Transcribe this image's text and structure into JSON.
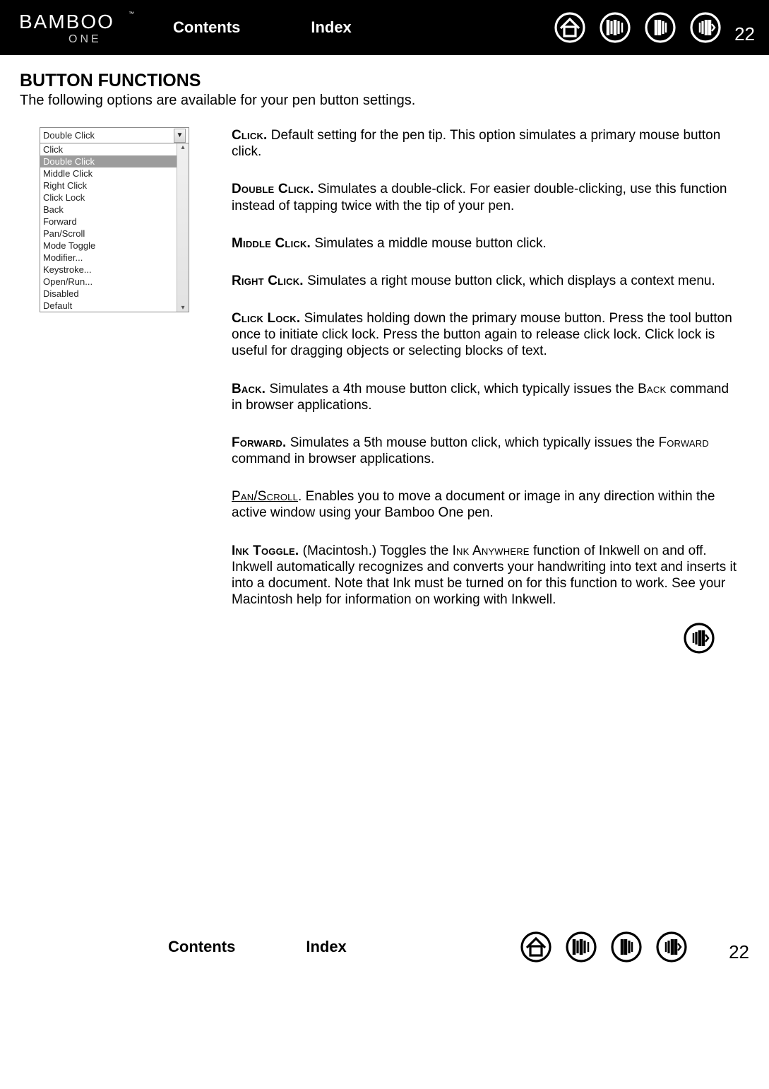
{
  "header": {
    "contents": "Contents",
    "index": "Index",
    "page": "22"
  },
  "title": "BUTTON FUNCTIONS",
  "intro": "The following options are available for your pen button settings.",
  "dropdown": {
    "selected": "Double Click",
    "items": [
      "Click",
      "Double Click",
      "Middle Click",
      "Right Click",
      "Click Lock",
      "Back",
      "Forward",
      "Pan/Scroll",
      "Mode Toggle",
      "Modifier...",
      "Keystroke...",
      "Open/Run...",
      "Disabled",
      "Default"
    ],
    "highlight_index": 1
  },
  "defs": {
    "click_term": "Click.",
    "click_body": "  Default setting for the pen tip.  This option simulates a primary mouse button click.",
    "double_term": "Double Click.",
    "double_body": "  Simulates a double-click.  For easier double-clicking, use this function instead of tapping twice with the tip of your pen.",
    "middle_term": "Middle Click.",
    "middle_body": "  Simulates a middle mouse button click.",
    "right_term": "Right Click.",
    "right_body": "  Simulates a right mouse button click, which displays a context menu.",
    "clicklock_term": "Click Lock.",
    "clicklock_body": "  Simulates holding down the primary mouse button.  Press the tool button once to initiate click lock.  Press the button again to release click lock.  Click lock is useful for dragging objects or selecting blocks of text.",
    "back_term": "Back.",
    "back_body_a": "  Simulates a 4th mouse button click, which typically issues the ",
    "back_sc": "Back",
    "back_body_b": " command in browser applications.",
    "forward_term": "Forward.",
    "forward_body_a": "  Simulates a 5th mouse button click, which typically issues the ",
    "forward_sc": "Forward",
    "forward_body_b": " command in browser applications.",
    "panscroll_term": "Pan/Scroll",
    "panscroll_body": ".  Enables you to move a document or image in any direction within the active window using your Bamboo One pen.",
    "ink_term": "Ink Toggle.",
    "ink_body_a": "  (Macintosh.)  Toggles the ",
    "ink_sc": "Ink Anywhere",
    "ink_body_b": " function of Inkwell on and off.  Inkwell automatically recognizes and converts your handwriting into text and inserts it into a document.  Note that Ink must be turned on for this function to work.  See your Macintosh help for information on working with Inkwell."
  },
  "footer": {
    "contents": "Contents",
    "index": "Index",
    "page": "22"
  }
}
